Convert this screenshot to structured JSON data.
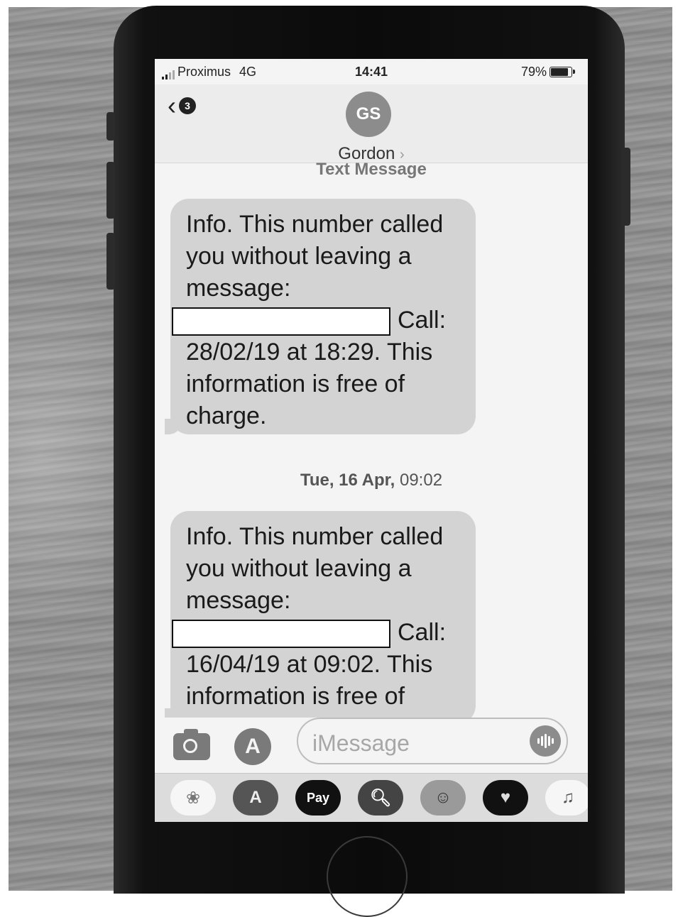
{
  "status_bar": {
    "carrier": "Proximus",
    "network": "4G",
    "time": "14:41",
    "battery": "79%"
  },
  "header": {
    "unread_count": "3",
    "avatar_initials": "GS",
    "contact_name": "Gordon",
    "contact_arrow": "›"
  },
  "service_label": "Text Message",
  "messages": [
    {
      "lines": [
        "Info. This number called",
        "you without leaving a",
        "message:",
        "Call:",
        "28/02/19 at 18:29. This",
        "information is free of",
        "charge."
      ]
    },
    {
      "lines": [
        "Info. This number called",
        "you without leaving a",
        "message:",
        "Call:",
        "16/04/19 at 09:02. This",
        "information is free of"
      ]
    }
  ],
  "timestamp": {
    "day": "Tue, 16 Apr,",
    "time": "09:02"
  },
  "composer": {
    "placeholder": "iMessage"
  },
  "app_tray": {
    "apple_pay_label": "Pay"
  },
  "colors": {
    "bubble": "#d3d3d3",
    "screen": "#f4f4f4",
    "phone_body": "#0b0b0b"
  },
  "icons": [
    "back-chevron-icon",
    "camera-icon",
    "app-store-icon",
    "audio-waveform-icon",
    "photos-icon",
    "apple-pay-icon",
    "web-search-icon",
    "memoji-icon",
    "digital-touch-icon",
    "music-icon"
  ]
}
